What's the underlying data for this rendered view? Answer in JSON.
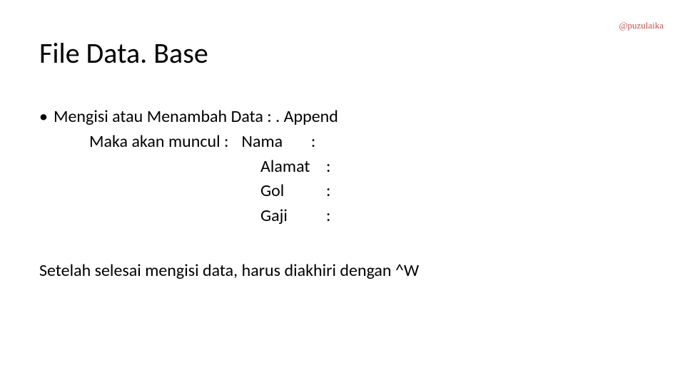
{
  "watermark": "@puzulaika",
  "title": "File Data. Base",
  "bullet": {
    "symbol": "•",
    "text": "Mengisi atau Menambah Data : . Append"
  },
  "prompt": {
    "lead": "Maka akan muncul :",
    "fields": [
      {
        "label": "Nama",
        "sep": ":"
      },
      {
        "label": "Alamat",
        "sep": ":"
      },
      {
        "label": "Gol",
        "sep": ":"
      },
      {
        "label": "Gaji",
        "sep": ":"
      }
    ]
  },
  "footer": "Setelah selesai mengisi data, harus diakhiri dengan ^W"
}
